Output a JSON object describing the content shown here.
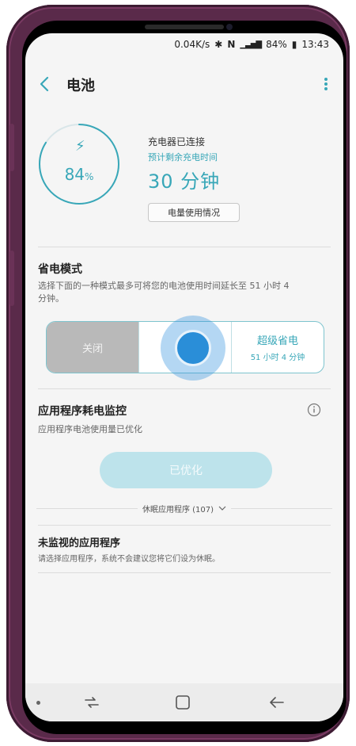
{
  "status_bar": {
    "speed": "0.04K/s",
    "battery": "84%",
    "time": "13:43"
  },
  "app_bar": {
    "title": "电池"
  },
  "battery": {
    "percent": "84",
    "percent_unit": "%",
    "charging": "充电器已连接",
    "estimate_label": "预计剩余充电时间",
    "time_left": "30 分钟",
    "usage_button": "电量使用情况",
    "level": 0.84
  },
  "power_saving": {
    "title": "省电模式",
    "description": "选择下面的一种模式最多可将您的电池使用时间延长至 51 小时 4 分钟。",
    "modes": [
      {
        "label": "关闭",
        "sub": ""
      },
      {
        "label": "省电",
        "sub": ""
      },
      {
        "label": "超级省电",
        "sub": "51 小时 4 分钟"
      }
    ]
  },
  "monitoring": {
    "title": "应用程序耗电监控",
    "description": "应用程序电池使用量已优化",
    "button": "已优化",
    "sleeping_apps": "休眠应用程序 (107)"
  },
  "unmonitored": {
    "title": "未监视的应用程序",
    "description": "请选择应用程序，系统不会建议您将它们设为休眠。"
  },
  "colors": {
    "accent": "#38a7b8",
    "phone_frame": "#5a2a4a",
    "touch": "#2a8ed8"
  }
}
